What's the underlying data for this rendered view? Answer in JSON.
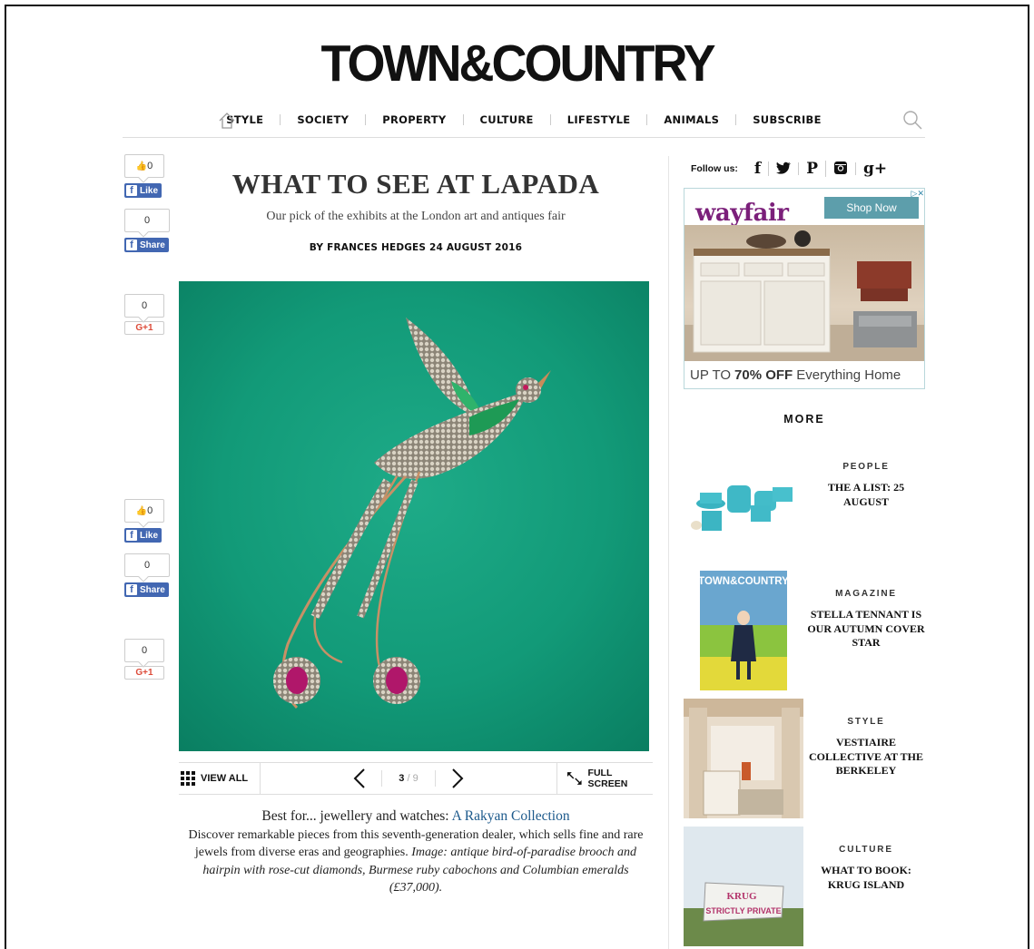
{
  "brand": {
    "logo_text": "TOWN&COUNTRY"
  },
  "nav": {
    "items": [
      "STYLE",
      "SOCIETY",
      "PROPERTY",
      "CULTURE",
      "LIFESTYLE",
      "ANIMALS",
      "SUBSCRIBE"
    ],
    "icons": {
      "home": "home-icon",
      "search": "search-icon"
    }
  },
  "social_left": {
    "top": {
      "like_count": "0",
      "like_label": "Like",
      "share_count": "0",
      "share_label": "Share",
      "gplus_count": "0",
      "gplus_label": "G+1"
    },
    "bottom": {
      "like_count": "0",
      "like_label": "Like",
      "share_count": "0",
      "share_label": "Share",
      "gplus_count": "0",
      "gplus_label": "G+1"
    }
  },
  "article": {
    "title": "WHAT TO SEE AT LAPADA",
    "subtitle": "Our pick of the exhibits at the London art and antiques fair",
    "byline": "BY FRANCES HEDGES 24 AUGUST 2016",
    "gallery": {
      "view_all": "VIEW ALL",
      "current": "3",
      "total": "/ 9",
      "full_screen": "FULL SCREEN"
    },
    "caption": {
      "lead_prefix": "Best for... jewellery and watches: ",
      "lead_link": "A Rakyan Collection",
      "body": "Discover remarkable pieces from this seventh-generation dealer, which sells fine and rare jewels from diverse eras and geographies. ",
      "italic": "Image: antique bird-of-paradise brooch and hairpin with rose-cut diamonds, Burmese ruby cabochons and Columbian emeralds (£37,000)."
    }
  },
  "follow": {
    "label": "Follow us:",
    "icons": [
      "facebook-icon",
      "twitter-icon",
      "pinterest-icon",
      "instagram-icon",
      "google-plus-icon"
    ],
    "glyphs": [
      "f",
      "🐦",
      "P",
      "◙",
      "g+"
    ]
  },
  "ad": {
    "brand": "wayfair",
    "button": "Shop Now",
    "offer_prefix": "UP TO",
    "offer_bold": "70% OFF",
    "offer_suffix": "Everything Home"
  },
  "more": {
    "heading": "MORE",
    "items": [
      {
        "category": "PEOPLE",
        "headline": "THE A LIST: 25 AUGUST"
      },
      {
        "category": "MAGAZINE",
        "headline": "STELLA TENNANT IS OUR AUTUMN COVER STAR",
        "thumb_masthead": "TOWN&COUNTRY"
      },
      {
        "category": "STYLE",
        "headline": "VESTIAIRE COLLECTIVE AT THE BERKELEY"
      },
      {
        "category": "CULTURE",
        "headline": "WHAT TO BOOK: KRUG ISLAND",
        "thumb_sign_1": "KRUG",
        "thumb_sign_2": "STRICTLY PRIVATE"
      }
    ]
  },
  "colors": {
    "accent_link": "#1d5a8c",
    "facebook": "#4267b2",
    "gplus": "#dd4b39",
    "hero_bg": "#15a07e",
    "wayfair": "#7b1f7a"
  }
}
